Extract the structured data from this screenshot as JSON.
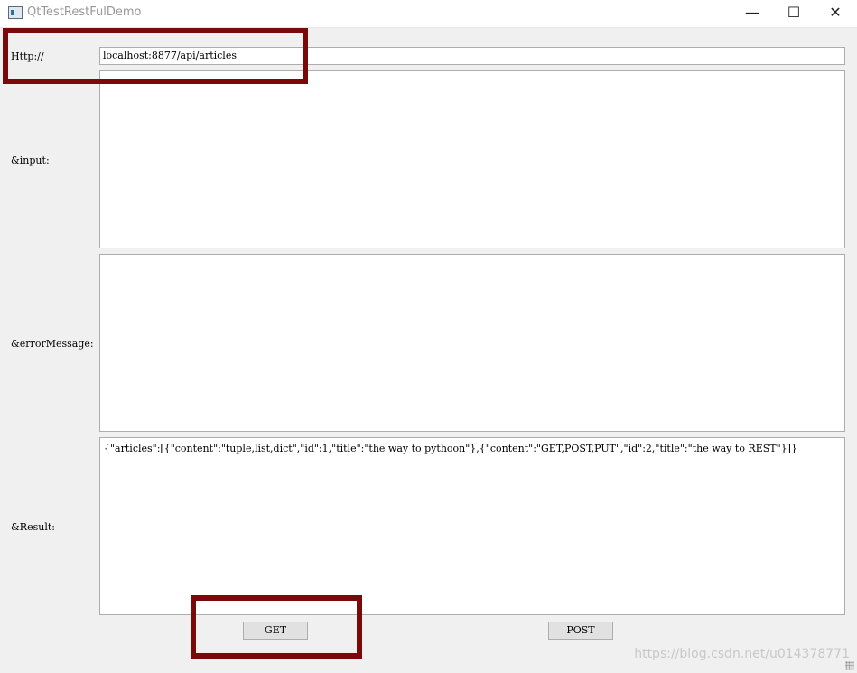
{
  "window": {
    "title": "QtTestRestFulDemo",
    "minimize": "—",
    "maximize": "☐",
    "close": "✕"
  },
  "form": {
    "http_label": "Http://",
    "url_value": "localhost:8877/api/articles",
    "input_label": "&input:",
    "error_label": "&errorMessage:",
    "result_label": "&Result:",
    "result_text": "{\"articles\":[{\"content\":\"tuple,list,dict\",\"id\":1,\"title\":\"the way to pythoon\"},{\"content\":\"GET,POST,PUT\",\"id\":2,\"title\":\"the way to REST\"}]}"
  },
  "buttons": {
    "get": "GET",
    "post": "POST"
  },
  "watermark": "https://blog.csdn.net/u014378771",
  "colors": {
    "highlight": "#7a0a0a"
  }
}
